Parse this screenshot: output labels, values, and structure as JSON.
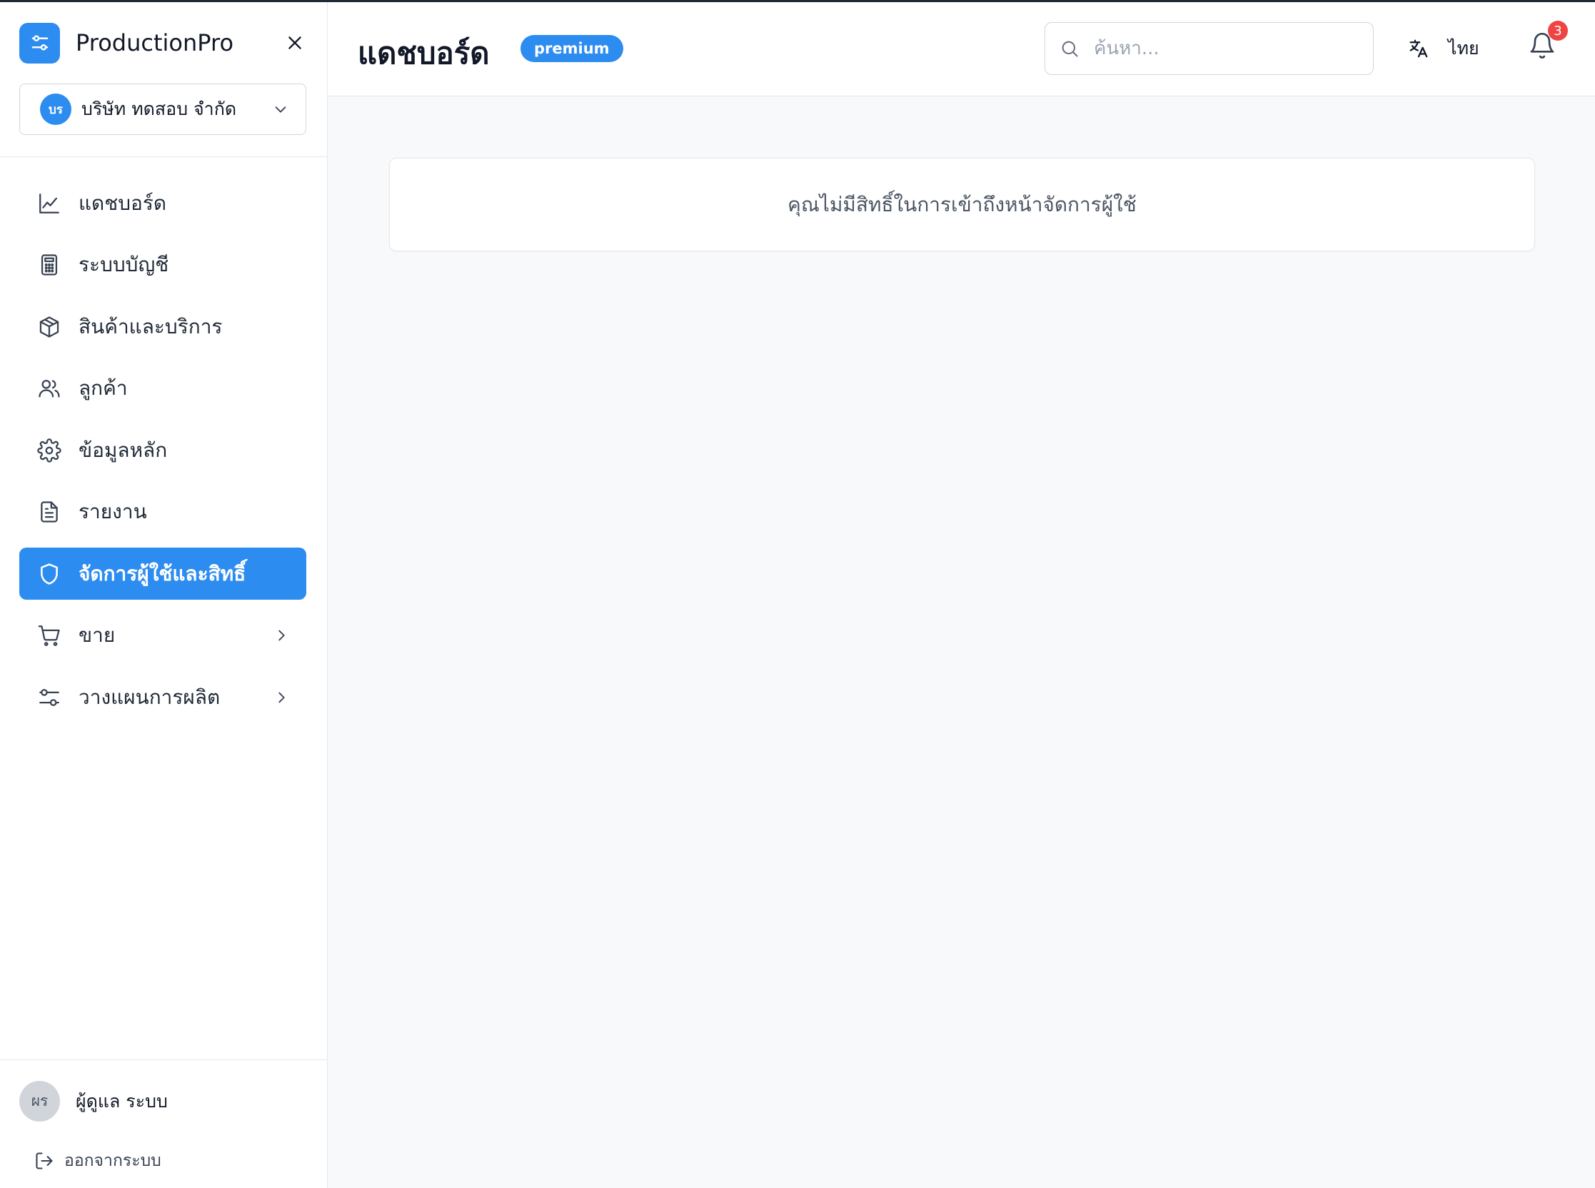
{
  "app": {
    "name": "ProductionPro"
  },
  "company": {
    "initials": "บร",
    "name": "บริษัท ทดสอบ จำกัด"
  },
  "nav": {
    "items": [
      {
        "label": "แดชบอร์ด",
        "icon": "chart-line-icon",
        "active": false
      },
      {
        "label": "ระบบบัญชี",
        "icon": "calculator-icon",
        "active": false
      },
      {
        "label": "สินค้าและบริการ",
        "icon": "package-icon",
        "active": false
      },
      {
        "label": "ลูกค้า",
        "icon": "users-icon",
        "active": false
      },
      {
        "label": "ข้อมูลหลัก",
        "icon": "gear-icon",
        "active": false
      },
      {
        "label": "รายงาน",
        "icon": "document-icon",
        "active": false
      },
      {
        "label": "จัดการผู้ใช้และสิทธิ์",
        "icon": "shield-icon",
        "active": true
      },
      {
        "label": "ขาย",
        "icon": "cart-icon",
        "active": false,
        "expandable": true
      },
      {
        "label": "วางแผนการผลิต",
        "icon": "sliders-icon",
        "active": false,
        "expandable": true
      }
    ]
  },
  "user": {
    "initials": "ผร",
    "name": "ผู้ดูแล ระบบ"
  },
  "logout": {
    "label": "ออกจากระบบ"
  },
  "header": {
    "title": "แดชบอร์ด",
    "badge": "premium",
    "search_placeholder": "ค้นหา...",
    "language": "ไทย",
    "notification_count": "3"
  },
  "content": {
    "message": "คุณไม่มีสิทธิ์ในการเข้าถึงหน้าจัดการผู้ใช้"
  },
  "colors": {
    "accent": "#2d8cf0",
    "notification": "#ef4444"
  }
}
